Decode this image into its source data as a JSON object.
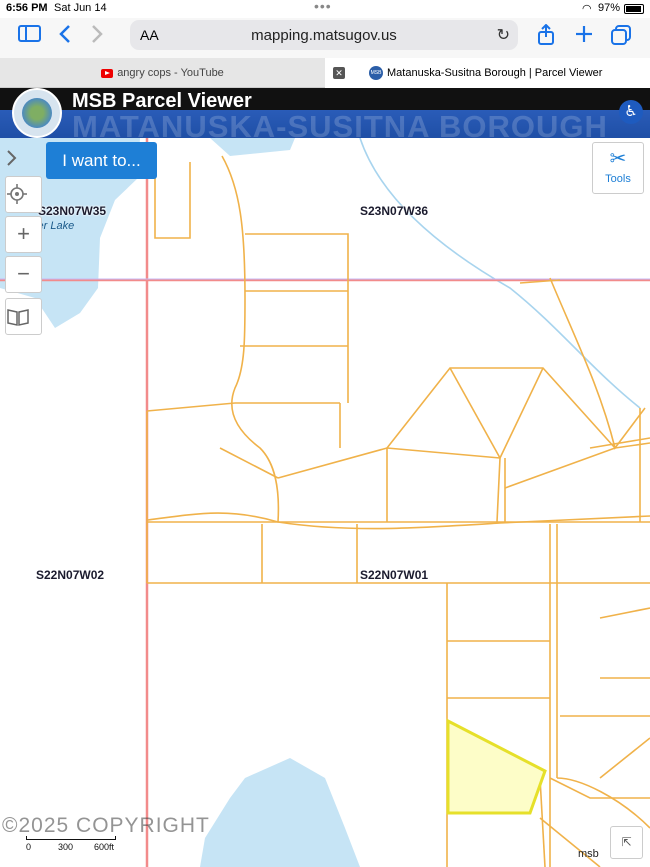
{
  "status": {
    "time": "6:56 PM",
    "date": "Sat Jun 14",
    "battery": "97%"
  },
  "browser": {
    "aa": "AA",
    "url": "mapping.matsugov.us"
  },
  "tabs": [
    {
      "label": "angry cops - YouTube"
    },
    {
      "label": "Matanuska-Susitna Borough | Parcel Viewer",
      "favicon_text": "MSB"
    }
  ],
  "header": {
    "title": "MSB Parcel Viewer",
    "subtitle": "MATANUSKA-SUSITNA BOROUGH"
  },
  "map": {
    "i_want_to": "I want to...",
    "tools_label": "Tools",
    "lake_label": "ker Lake",
    "sections": [
      "S23N07W35",
      "S23N07W36",
      "S22N07W02",
      "S22N07W01"
    ],
    "copyright": "©2025 COPYRIGHT",
    "scale": [
      "0",
      "300",
      "600ft"
    ],
    "attribution": "msb"
  },
  "colors": {
    "parcel_line": "#f0b24a",
    "section_line": "#f28b8b",
    "water": "#c6e4f5",
    "selected_fill": "#fdfdc8",
    "selected_stroke": "#e6e02a"
  }
}
